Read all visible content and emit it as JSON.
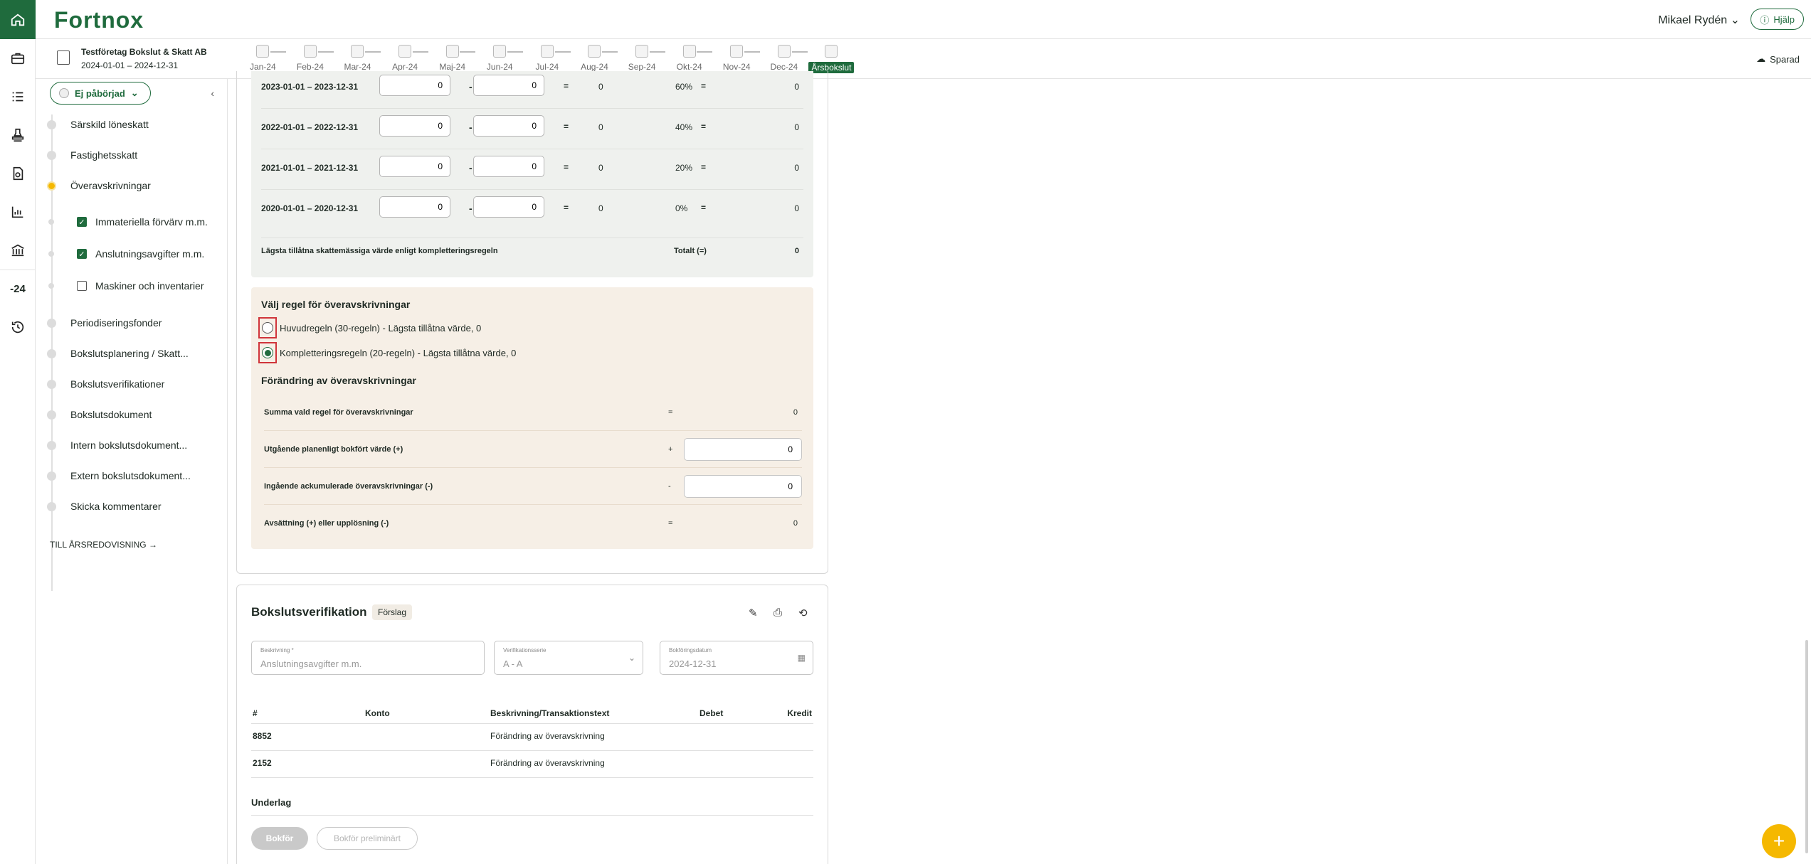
{
  "app": {
    "logo": "Fortnox",
    "user_name": "Mikael Rydén",
    "help_label": "Hjälp"
  },
  "company": {
    "name": "Testföretag Bokslut & Skatt AB",
    "period": "2024-01-01 – 2024-12-31"
  },
  "months": [
    "Jan-24",
    "Feb-24",
    "Mar-24",
    "Apr-24",
    "Maj-24",
    "Jun-24",
    "Jul-24",
    "Aug-24",
    "Sep-24",
    "Okt-24",
    "Nov-24",
    "Dec-24",
    "Årsbokslut"
  ],
  "saved_label": "Sparad",
  "rail": {
    "year_label": "-24"
  },
  "sidebar": {
    "status_label": "Ej påbörjad",
    "items": [
      {
        "label": "Särskild löneskatt",
        "type": "main",
        "state": "todo"
      },
      {
        "label": "Fastighetsskatt",
        "type": "main",
        "state": "todo"
      },
      {
        "label": "Överavskrivningar",
        "type": "main",
        "state": "active"
      },
      {
        "label": "Immateriella förvärv m.m.",
        "type": "sub",
        "checked": true
      },
      {
        "label": "Anslutningsavgifter m.m.",
        "type": "sub",
        "checked": true
      },
      {
        "label": "Maskiner och inventarier",
        "type": "sub",
        "checked": false
      },
      {
        "label": "Periodiseringsfonder",
        "type": "main",
        "state": "todo"
      },
      {
        "label": "Bokslutsplanering / Skatt...",
        "type": "main",
        "state": "todo"
      },
      {
        "label": "Bokslutsverifikationer",
        "type": "main",
        "state": "todo"
      },
      {
        "label": "Bokslutsdokument",
        "type": "main",
        "state": "todo"
      },
      {
        "label": "Intern bokslutsdokument...",
        "type": "main",
        "state": "todo"
      },
      {
        "label": "Extern bokslutsdokument...",
        "type": "main",
        "state": "todo"
      },
      {
        "label": "Skicka kommentarer",
        "type": "main",
        "state": "todo"
      }
    ],
    "to_annual_label": "TILL ÅRSREDOVISNING"
  },
  "calc": {
    "rows": [
      {
        "period": "2023-01-01 – 2023-12-31",
        "a": "0",
        "b": "0",
        "diff": "0",
        "pct": "60%",
        "result": "0"
      },
      {
        "period": "2022-01-01 – 2022-12-31",
        "a": "0",
        "b": "0",
        "diff": "0",
        "pct": "40%",
        "result": "0"
      },
      {
        "period": "2021-01-01 – 2021-12-31",
        "a": "0",
        "b": "0",
        "diff": "0",
        "pct": "20%",
        "result": "0"
      },
      {
        "period": "2020-01-01 – 2020-12-31",
        "a": "0",
        "b": "0",
        "diff": "0",
        "pct": "0%",
        "result": "0"
      }
    ],
    "minus": "-",
    "equals": "=",
    "total_label": "Lägsta tillåtna skattemässiga värde enligt kompletteringsregeln",
    "total_sum_label": "Totalt (=)",
    "total_value": "0"
  },
  "rule": {
    "title": "Välj regel för överavskrivningar",
    "options": [
      {
        "label": "Huvudregeln (30-regeln) - Lägsta tillåtna värde, 0",
        "selected": false
      },
      {
        "label": "Kompletteringsregeln (20-regeln) - Lägsta tillåtna värde, 0",
        "selected": true
      }
    ],
    "change_title": "Förändring av överavskrivningar",
    "change_rows": [
      {
        "label": "Summa vald regel för överavskrivningar",
        "op": "=",
        "value": "0",
        "input": false
      },
      {
        "label": "Utgående planenligt bokfört värde (+)",
        "op": "+",
        "value": "0",
        "input": true
      },
      {
        "label": "Ingående ackumulerade överavskrivningar (-)",
        "op": "-",
        "value": "0",
        "input": true
      },
      {
        "label": "Avsättning (+) eller upplösning (-)",
        "op": "=",
        "value": "0",
        "input": false
      }
    ]
  },
  "verification": {
    "title": "Bokslutsverifikation",
    "badge": "Förslag",
    "description": {
      "label": "Beskrivning *",
      "placeholder": "Anslutningsavgifter m.m."
    },
    "series": {
      "label": "Verifikationsserie",
      "value": "A - A"
    },
    "date": {
      "label": "Bokföringsdatum",
      "value": "2024-12-31"
    },
    "columns": {
      "num": "#",
      "account": "Konto",
      "desc": "Beskrivning/Transaktionstext",
      "debit": "Debet",
      "credit": "Kredit"
    },
    "rows": [
      {
        "num": "8852",
        "account": "",
        "desc": "Förändring av överavskrivning",
        "debit": "",
        "credit": ""
      },
      {
        "num": "2152",
        "account": "",
        "desc": "Förändring av överavskrivning",
        "debit": "",
        "credit": ""
      }
    ],
    "underlag_label": "Underlag",
    "book_label": "Bokför",
    "book_prelim_label": "Bokför preliminärt"
  }
}
